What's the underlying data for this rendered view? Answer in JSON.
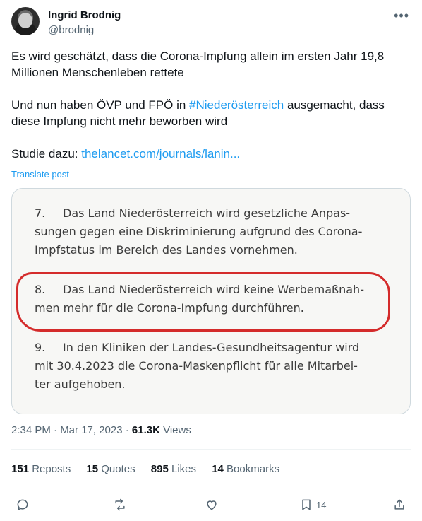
{
  "author": {
    "name": "Ingrid Brodnig",
    "handle": "@brodnig"
  },
  "tweet": {
    "p1": "Es wird geschätzt, dass die Corona-Impfung allein im ersten Jahr 19,8 Millionen Menschenleben rettete",
    "p2_before": "Und nun haben ÖVP und FPÖ in ",
    "p2_hashtag": "#Niederösterreich",
    "p2_after": " ausgemacht, dass diese Impfung nicht mehr beworben wird",
    "p3_label": "Studie dazu: ",
    "p3_link": "thelancet.com/journals/lanin...",
    "translate": "Translate post"
  },
  "document": {
    "items": [
      {
        "num": "7.",
        "lines": [
          "Das Land Niederösterreich wird gesetzliche Anpas-",
          "sungen gegen eine Diskriminierung aufgrund des Corona-",
          "Impfstatus im Bereich des Landes vornehmen."
        ]
      },
      {
        "num": "8.",
        "lines": [
          "Das Land Niederösterreich wird keine Werbemaßnah-",
          "men mehr für die Corona-Impfung durchführen."
        ]
      },
      {
        "num": "9.",
        "lines": [
          "In den Kliniken der Landes-Gesundheitsagentur wird",
          "mit 30.4.2023 die Corona-Maskenpflicht für alle Mitarbei-",
          "ter aufgehoben."
        ]
      }
    ]
  },
  "meta": {
    "time": "2:34 PM · Mar 17, 2023 · ",
    "views_count": "61.3K",
    "views_label": " Views"
  },
  "stats": {
    "reposts_count": "151",
    "reposts_label": " Reposts",
    "quotes_count": "15",
    "quotes_label": " Quotes",
    "likes_count": "895",
    "likes_label": " Likes",
    "bookmarks_count": "14",
    "bookmarks_label": " Bookmarks"
  },
  "actions": {
    "bookmark_count": "14"
  },
  "icons": [
    "more-icon",
    "reply-icon",
    "repost-icon",
    "like-icon",
    "bookmark-icon",
    "share-icon"
  ],
  "colors": {
    "link": "#1d9bf0",
    "highlight_circle": "#d42b2b",
    "secondary_text": "#536471"
  }
}
